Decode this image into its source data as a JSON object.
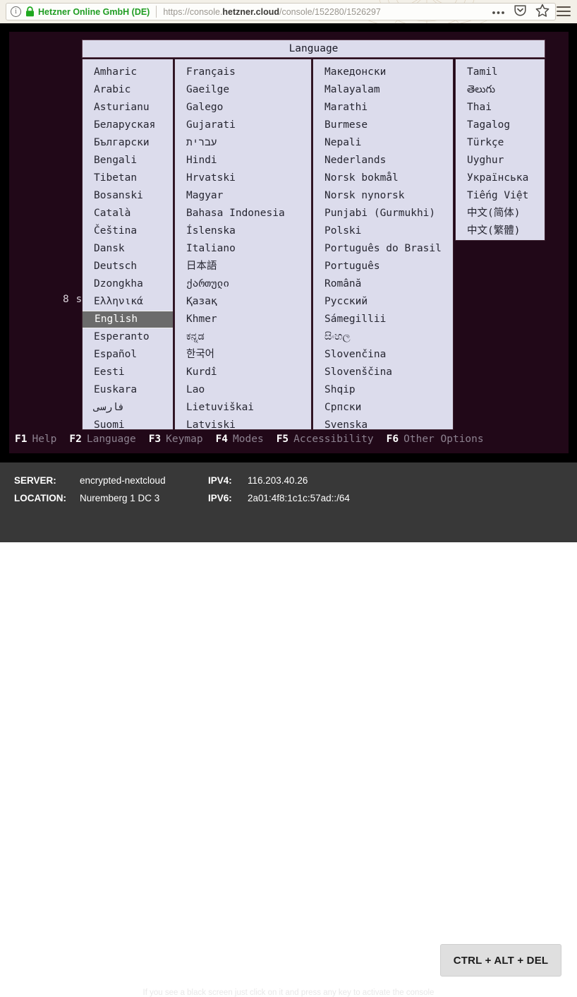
{
  "browser": {
    "identity_label": "Hetzner Online GmbH (DE)",
    "url_scheme": "https://console.",
    "url_domain": "hetzner.cloud",
    "url_path": "/console/152280/1526297",
    "info_glyph": "i",
    "icons": {
      "lock": "lock-icon",
      "info": "info-icon",
      "more": "•••",
      "pocket": "pocket-icon",
      "bookmark": "star-icon",
      "menu": "hamburger-menu-icon"
    }
  },
  "terminal": {
    "countdown": "8 s",
    "dialog": {
      "title": "Language",
      "columns": [
        {
          "name": "column-1",
          "items": [
            {
              "label": "Amharic",
              "selected": false
            },
            {
              "label": "Arabic",
              "selected": false
            },
            {
              "label": "Asturianu",
              "selected": false
            },
            {
              "label": "Беларуская",
              "selected": false
            },
            {
              "label": "Български",
              "selected": false
            },
            {
              "label": "Bengali",
              "selected": false
            },
            {
              "label": "Tibetan",
              "selected": false
            },
            {
              "label": "Bosanski",
              "selected": false
            },
            {
              "label": "Català",
              "selected": false
            },
            {
              "label": "Čeština",
              "selected": false
            },
            {
              "label": "Dansk",
              "selected": false
            },
            {
              "label": "Deutsch",
              "selected": false
            },
            {
              "label": "Dzongkha",
              "selected": false
            },
            {
              "label": "Ελληνικά",
              "selected": false
            },
            {
              "label": "English",
              "selected": true
            },
            {
              "label": "Esperanto",
              "selected": false
            },
            {
              "label": "Español",
              "selected": false
            },
            {
              "label": "Eesti",
              "selected": false
            },
            {
              "label": "Euskara",
              "selected": false
            },
            {
              "label": "فارسی",
              "selected": false
            },
            {
              "label": "Suomi",
              "selected": false
            }
          ]
        },
        {
          "name": "column-2",
          "items": [
            {
              "label": "Français",
              "selected": false
            },
            {
              "label": "Gaeilge",
              "selected": false
            },
            {
              "label": "Galego",
              "selected": false
            },
            {
              "label": "Gujarati",
              "selected": false
            },
            {
              "label": "עברית",
              "selected": false
            },
            {
              "label": "Hindi",
              "selected": false
            },
            {
              "label": "Hrvatski",
              "selected": false
            },
            {
              "label": "Magyar",
              "selected": false
            },
            {
              "label": "Bahasa Indonesia",
              "selected": false
            },
            {
              "label": "Íslenska",
              "selected": false
            },
            {
              "label": "Italiano",
              "selected": false
            },
            {
              "label": "日本語",
              "selected": false
            },
            {
              "label": "ქართული",
              "selected": false
            },
            {
              "label": "Қазақ",
              "selected": false
            },
            {
              "label": "Khmer",
              "selected": false
            },
            {
              "label": "ಕನ್ನಡ",
              "selected": false
            },
            {
              "label": "한국어",
              "selected": false
            },
            {
              "label": "Kurdî",
              "selected": false
            },
            {
              "label": "Lao",
              "selected": false
            },
            {
              "label": "Lietuviškai",
              "selected": false
            },
            {
              "label": "Latviski",
              "selected": false
            }
          ]
        },
        {
          "name": "column-3",
          "items": [
            {
              "label": "Македонски",
              "selected": false
            },
            {
              "label": "Malayalam",
              "selected": false
            },
            {
              "label": "Marathi",
              "selected": false
            },
            {
              "label": "Burmese",
              "selected": false
            },
            {
              "label": "Nepali",
              "selected": false
            },
            {
              "label": "Nederlands",
              "selected": false
            },
            {
              "label": "Norsk bokmål",
              "selected": false
            },
            {
              "label": "Norsk nynorsk",
              "selected": false
            },
            {
              "label": "Punjabi (Gurmukhi)",
              "selected": false
            },
            {
              "label": "Polski",
              "selected": false
            },
            {
              "label": "Português do Brasil",
              "selected": false
            },
            {
              "label": "Português",
              "selected": false
            },
            {
              "label": "Română",
              "selected": false
            },
            {
              "label": "Русский",
              "selected": false
            },
            {
              "label": "Sámegillii",
              "selected": false
            },
            {
              "label": "සිංහල",
              "selected": false
            },
            {
              "label": "Slovenčina",
              "selected": false
            },
            {
              "label": "Slovenščina",
              "selected": false
            },
            {
              "label": "Shqip",
              "selected": false
            },
            {
              "label": "Српски",
              "selected": false
            },
            {
              "label": "Svenska",
              "selected": false
            }
          ]
        },
        {
          "name": "column-4",
          "items": [
            {
              "label": "Tamil",
              "selected": false
            },
            {
              "label": "తెలుగు",
              "selected": false
            },
            {
              "label": "Thai",
              "selected": false
            },
            {
              "label": "Tagalog",
              "selected": false
            },
            {
              "label": "Türkçe",
              "selected": false
            },
            {
              "label": "Uyghur",
              "selected": false
            },
            {
              "label": "Українська",
              "selected": false
            },
            {
              "label": "Tiếng Việt",
              "selected": false
            },
            {
              "label": "中文(简体)",
              "selected": false
            },
            {
              "label": "中文(繁體)",
              "selected": false
            }
          ]
        }
      ]
    },
    "function_keys": [
      {
        "key": "F1",
        "label": "Help"
      },
      {
        "key": "F2",
        "label": "Language"
      },
      {
        "key": "F3",
        "label": "Keymap"
      },
      {
        "key": "F4",
        "label": "Modes"
      },
      {
        "key": "F5",
        "label": "Accessibility"
      },
      {
        "key": "F6",
        "label": "Other Options"
      }
    ]
  },
  "info_panel": {
    "rows": [
      {
        "key": "SERVER:",
        "value": "encrypted-nextcloud",
        "key2": "IPV4:",
        "value2": "116.203.40.26"
      },
      {
        "key": "LOCATION:",
        "value": "Nuremberg 1 DC 3",
        "key2": "IPV6:",
        "value2": "2a01:4f8:1c1c:57ad::/64"
      }
    ],
    "cad_button": "CTRL + ALT + DEL",
    "hint": "If you see a black screen just click on it and press any key to activate the console"
  },
  "colors": {
    "terminal_bg": "#210818",
    "dialog_bg": "#dcdcec",
    "selection_bg": "#6b6b6b",
    "identity_green": "#1f9d22",
    "info_panel_bg": "#383838"
  }
}
